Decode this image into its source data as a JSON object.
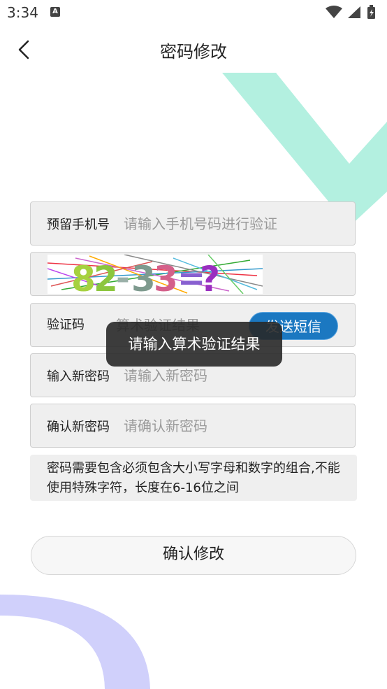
{
  "status_bar": {
    "time": "3:34",
    "notification_icon": "a-icon",
    "icons": [
      "wifi-icon",
      "signal-icon",
      "battery-icon"
    ]
  },
  "header": {
    "title": "密码修改",
    "back_icon": "chevron-left-icon"
  },
  "form": {
    "phone": {
      "label": "预留手机号",
      "placeholder": "请输入手机号码进行验证"
    },
    "captcha": {
      "text": "82-33=?"
    },
    "code": {
      "label": "验证码",
      "placeholder": "算术验证结果",
      "send_button": "发送短信"
    },
    "new_password": {
      "label": "输入新密码",
      "placeholder": "请输入新密码"
    },
    "confirm_password": {
      "label": "确认新密码",
      "placeholder": "请确认新密码"
    }
  },
  "hint": "密码需要包含必须包含大小写字母和数字的组合,不能使用特殊字符，长度在6-16位之间",
  "confirm_button": "确认修改",
  "toast": "请输入算术验证结果",
  "colors": {
    "accent_blue": "#1b78c1",
    "deco_green": "#b3f0e0",
    "deco_purple": "#d0d0fb"
  }
}
